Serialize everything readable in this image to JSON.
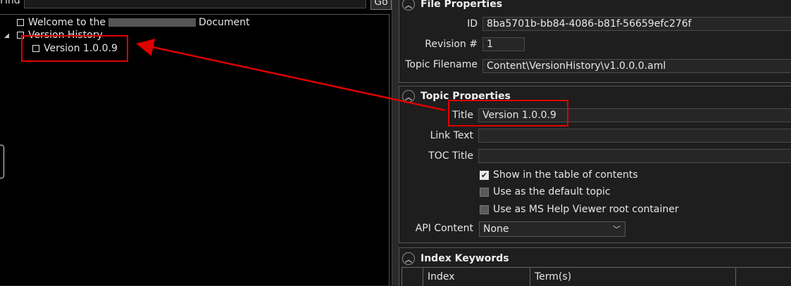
{
  "find": {
    "label": "Find",
    "value": "",
    "go_label": "Go"
  },
  "tree": {
    "items": [
      {
        "label_prefix": "Welcome to the",
        "label_suffix": "Document"
      },
      {
        "label": "Version History",
        "expander": "◢"
      },
      {
        "label": "Version 1.0.0.9"
      }
    ]
  },
  "file_properties": {
    "header": "File Properties",
    "id_label": "ID",
    "id_value": "8ba5701b-bb84-4086-b81f-56659efc276f",
    "revision_label": "Revision #",
    "revision_value": "1",
    "filename_label": "Topic Filename",
    "filename_value": "Content\\VersionHistory\\v1.0.0.0.aml"
  },
  "topic_properties": {
    "header": "Topic Properties",
    "title_label": "Title",
    "title_value": "Version 1.0.0.9",
    "link_text_label": "Link Text",
    "link_text_value": "",
    "toc_title_label": "TOC Title",
    "toc_title_value": "",
    "checkboxes": [
      {
        "label": "Show in the table of contents",
        "checked": true
      },
      {
        "label": "Use as the default topic",
        "checked": false
      },
      {
        "label": "Use as MS Help Viewer root container",
        "checked": false
      }
    ],
    "api_content_label": "API Content",
    "api_content_value": "None"
  },
  "index_keywords": {
    "header": "Index Keywords",
    "columns": [
      "Index",
      "Term(s)"
    ]
  },
  "icons": {
    "collapse": "chevron-up-icon",
    "dropdown": "chevron-down-icon",
    "checkmark": "check-icon"
  },
  "colors": {
    "annotation": "#e00000",
    "background": "#1e1e1e"
  }
}
